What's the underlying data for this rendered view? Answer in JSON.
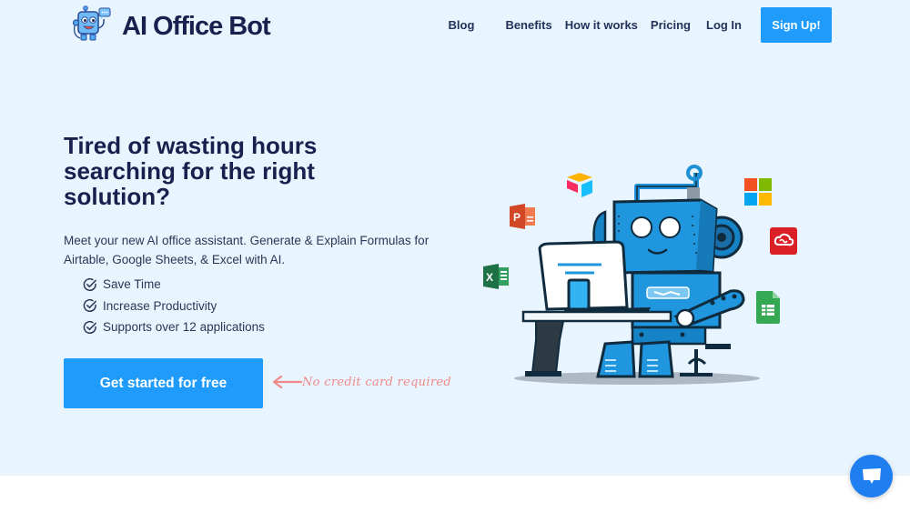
{
  "brand": {
    "name": "AI Office Bot",
    "logo_icon": "robot-mascot-icon"
  },
  "nav": {
    "items": [
      {
        "label": "Blog"
      },
      {
        "label": "Benefits"
      },
      {
        "label": "How it works"
      },
      {
        "label": "Pricing"
      },
      {
        "label": "Log In"
      }
    ],
    "signup_label": "Sign Up!"
  },
  "hero": {
    "headline": "Tired of wasting hours searching for the right solution?",
    "subtext": "Meet your new AI office assistant. Generate & Explain Formulas for Airtable, Google Sheets, & Excel with AI.",
    "features": [
      {
        "label": "Save Time",
        "icon": "check-circle-icon"
      },
      {
        "label": "Increase Productivity",
        "icon": "check-circle-icon"
      },
      {
        "label": "Supports over 12 applications",
        "icon": "check-circle-icon"
      }
    ],
    "cta_label": "Get started for free",
    "cta_note": "No credit card required"
  },
  "illustration": {
    "subject": "robot-at-computer",
    "app_icons": [
      "airtable-icon",
      "powerpoint-icon",
      "excel-icon",
      "microsoft-icon",
      "creative-cloud-icon",
      "google-sheets-icon"
    ]
  },
  "colors": {
    "hero_bg": "#e8f4fe",
    "primary": "#1e9bfb",
    "heading": "#16224d",
    "note": "#f08a8a",
    "chat": "#1f7ef0"
  },
  "chat_widget": {
    "icon": "chat-bubble-icon"
  }
}
